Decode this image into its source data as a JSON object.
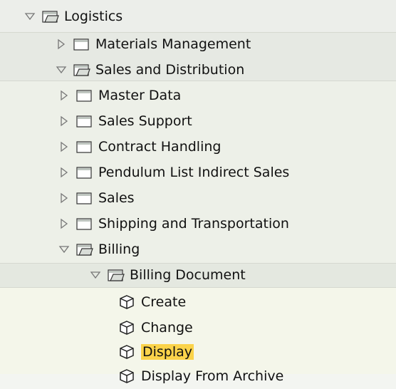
{
  "tree": [
    {
      "id": "logistics",
      "label": "Logistics",
      "level": 0,
      "type": "folder",
      "state": "expanded"
    },
    {
      "id": "materials-management",
      "label": "Materials Management",
      "level": 1,
      "type": "folder",
      "state": "collapsed"
    },
    {
      "id": "sales-and-distribution",
      "label": "Sales and Distribution",
      "level": 1,
      "type": "folder",
      "state": "expanded"
    },
    {
      "id": "master-data",
      "label": "Master Data",
      "level": 2,
      "type": "folder",
      "state": "collapsed"
    },
    {
      "id": "sales-support",
      "label": "Sales Support",
      "level": 2,
      "type": "folder",
      "state": "collapsed"
    },
    {
      "id": "contract-handling",
      "label": "Contract Handling",
      "level": 2,
      "type": "folder",
      "state": "collapsed"
    },
    {
      "id": "pendulum-list-indirect-sales",
      "label": "Pendulum List Indirect Sales",
      "level": 2,
      "type": "folder",
      "state": "collapsed"
    },
    {
      "id": "sales",
      "label": "Sales",
      "level": 2,
      "type": "folder",
      "state": "collapsed"
    },
    {
      "id": "shipping-and-transportation",
      "label": "Shipping and Transportation",
      "level": 2,
      "type": "folder",
      "state": "collapsed"
    },
    {
      "id": "billing",
      "label": "Billing",
      "level": 2,
      "type": "folder",
      "state": "expanded"
    },
    {
      "id": "billing-document",
      "label": "Billing Document",
      "level": 3,
      "type": "folder",
      "state": "expanded"
    },
    {
      "id": "create",
      "label": "Create",
      "level": 4,
      "type": "transaction"
    },
    {
      "id": "change",
      "label": "Change",
      "level": 4,
      "type": "transaction"
    },
    {
      "id": "display",
      "label": "Display",
      "level": 4,
      "type": "transaction",
      "selected": true
    },
    {
      "id": "display-from-archive",
      "label": "Display From Archive",
      "level": 4,
      "type": "transaction"
    }
  ],
  "colors": {
    "band_level0": "#eef0ec",
    "band_level1": "#e9ece6",
    "band_level2": "#eef1e9",
    "band_level3": "#e7ebe3",
    "band_level4": "#f4f6ea",
    "selection": "#fbd34a"
  }
}
